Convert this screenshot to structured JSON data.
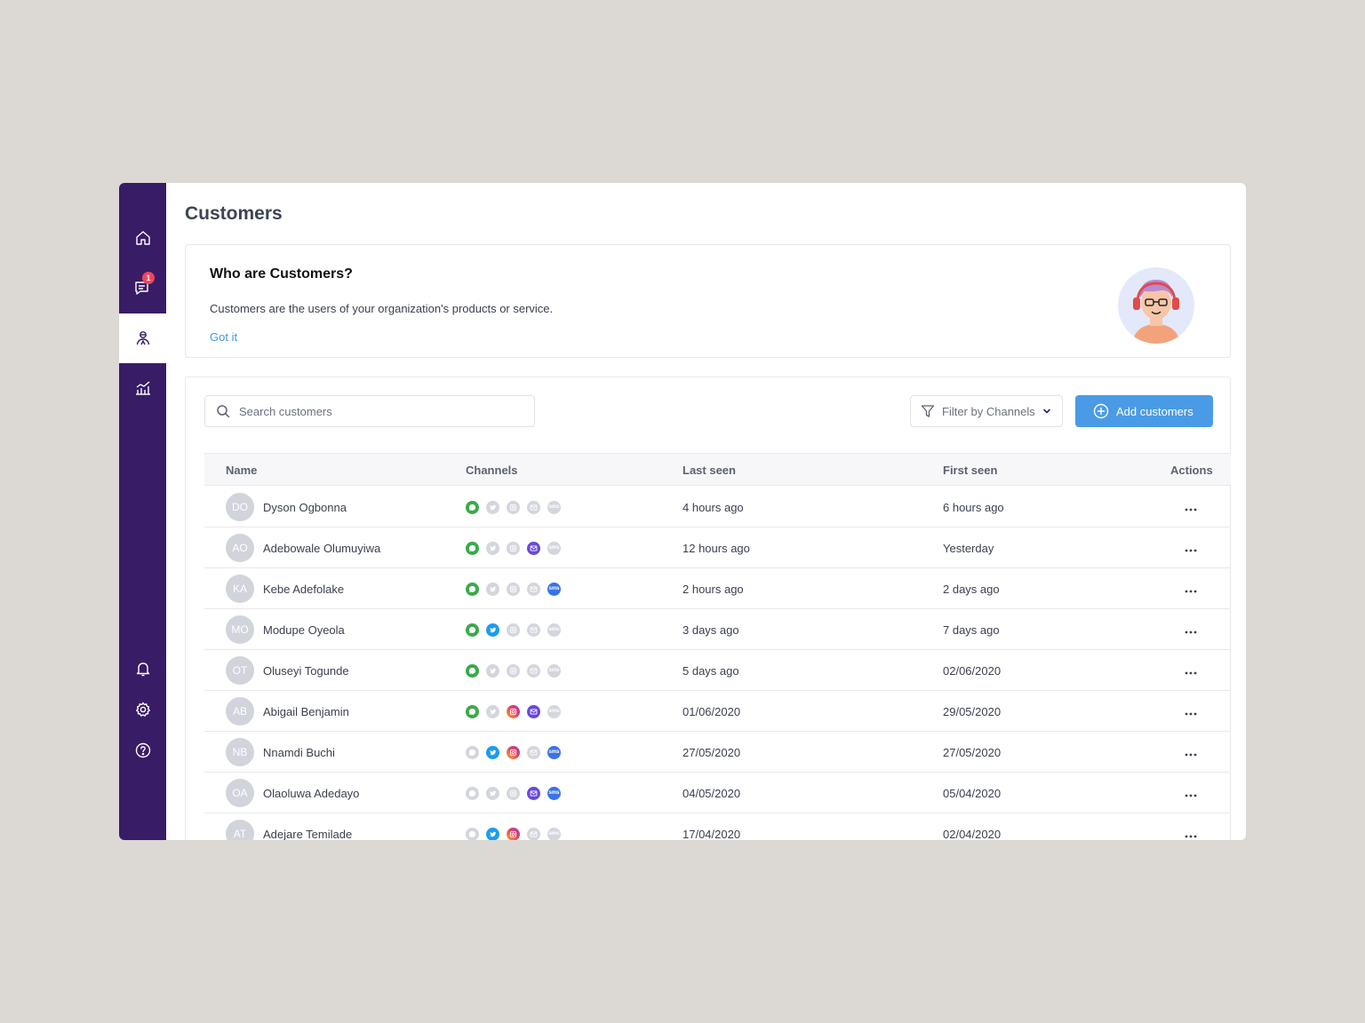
{
  "sidebar": {
    "notification_count": "1"
  },
  "page": {
    "title": "Customers"
  },
  "info": {
    "title": "Who are Customers?",
    "description": "Customers are the users of your organization's products or service.",
    "link": "Got it"
  },
  "toolbar": {
    "search_placeholder": "Search customers",
    "filter_label": "Filter by Channels",
    "add_label": "Add customers"
  },
  "table": {
    "headers": {
      "name": "Name",
      "channels": "Channels",
      "last_seen": "Last seen",
      "first_seen": "First seen",
      "actions": "Actions"
    },
    "rows": [
      {
        "initials": "DO",
        "name": "Dyson Ogbonna",
        "last_seen": "4 hours ago",
        "first_seen": "6 hours ago",
        "channels": {
          "whatsapp": true,
          "twitter": false,
          "instagram": false,
          "email": false,
          "sms": false
        }
      },
      {
        "initials": "AO",
        "name": "Adebowale Olumuyiwa",
        "last_seen": "12 hours ago",
        "first_seen": "Yesterday",
        "channels": {
          "whatsapp": true,
          "twitter": false,
          "instagram": false,
          "email": true,
          "sms": false
        }
      },
      {
        "initials": "KA",
        "name": "Kebe Adefolake",
        "last_seen": "2 hours ago",
        "first_seen": "2 days ago",
        "channels": {
          "whatsapp": true,
          "twitter": false,
          "instagram": false,
          "email": false,
          "sms": true
        }
      },
      {
        "initials": "MO",
        "name": "Modupe Oyeola",
        "last_seen": "3 days ago",
        "first_seen": "7 days ago",
        "channels": {
          "whatsapp": true,
          "twitter": true,
          "instagram": false,
          "email": false,
          "sms": false
        }
      },
      {
        "initials": "OT",
        "name": "Oluseyi Togunde",
        "last_seen": "5 days ago",
        "first_seen": "02/06/2020",
        "channels": {
          "whatsapp": true,
          "twitter": false,
          "instagram": false,
          "email": false,
          "sms": false
        }
      },
      {
        "initials": "AB",
        "name": "Abigail Benjamin",
        "last_seen": "01/06/2020",
        "first_seen": "29/05/2020",
        "channels": {
          "whatsapp": true,
          "twitter": false,
          "instagram": true,
          "email": true,
          "sms": false
        }
      },
      {
        "initials": "NB",
        "name": "Nnamdi Buchi",
        "last_seen": "27/05/2020",
        "first_seen": "27/05/2020",
        "channels": {
          "whatsapp": false,
          "twitter": true,
          "instagram": true,
          "email": false,
          "sms": true
        }
      },
      {
        "initials": "OA",
        "name": "Olaoluwa Adedayo",
        "last_seen": "04/05/2020",
        "first_seen": "05/04/2020",
        "channels": {
          "whatsapp": false,
          "twitter": false,
          "instagram": false,
          "email": true,
          "sms": true
        }
      },
      {
        "initials": "AT",
        "name": "Adejare Temilade",
        "last_seen": "17/04/2020",
        "first_seen": "02/04/2020",
        "channels": {
          "whatsapp": false,
          "twitter": true,
          "instagram": true,
          "email": false,
          "sms": false
        }
      }
    ]
  },
  "colors": {
    "sidebar": "#391c66",
    "accent": "#4a9be6",
    "badge": "#f0455c",
    "whatsapp": "#3aa94b",
    "twitter": "#1d9bf0",
    "email": "#6a48d9",
    "sms": "#3a73e6"
  },
  "icons": {
    "nav": [
      "home-icon",
      "messages-icon",
      "customers-icon",
      "analytics-icon",
      "bell-icon",
      "gear-icon",
      "help-icon"
    ],
    "channels": [
      "whatsapp-icon",
      "twitter-icon",
      "instagram-icon",
      "email-icon",
      "sms-icon"
    ]
  }
}
